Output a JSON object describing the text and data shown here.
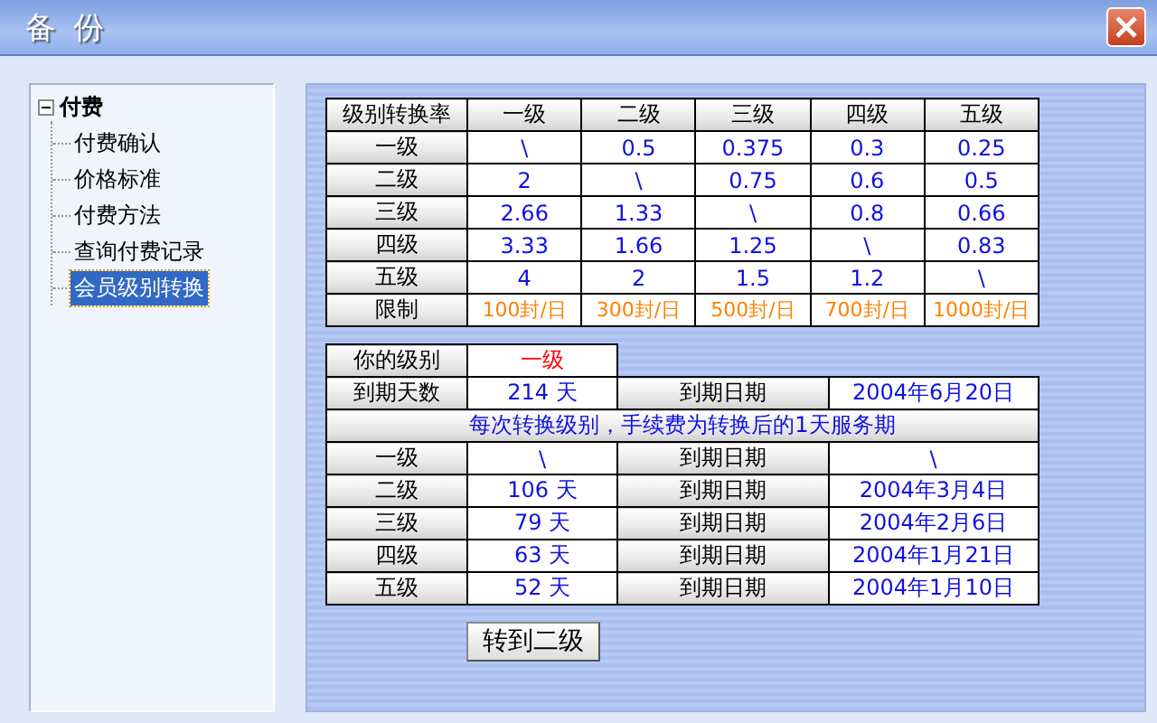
{
  "window": {
    "title": "备 份"
  },
  "tree": {
    "label": "付费",
    "expanded": true,
    "children": [
      {
        "label": "付费确认",
        "selected": false
      },
      {
        "label": "价格标准",
        "selected": false
      },
      {
        "label": "付费方法",
        "selected": false
      },
      {
        "label": "查询付费记录",
        "selected": false
      },
      {
        "label": "会员级别转换",
        "selected": true
      }
    ]
  },
  "rate_table": {
    "header": [
      "级别转换率",
      "一级",
      "二级",
      "三级",
      "四级",
      "五级"
    ],
    "rows": [
      {
        "label": "一级",
        "cells": [
          "\\",
          "0.5",
          "0.375",
          "0.3",
          "0.25"
        ]
      },
      {
        "label": "二级",
        "cells": [
          "2",
          "\\",
          "0.75",
          "0.6",
          "0.5"
        ]
      },
      {
        "label": "三级",
        "cells": [
          "2.66",
          "1.33",
          "\\",
          "0.8",
          "0.66"
        ]
      },
      {
        "label": "四级",
        "cells": [
          "3.33",
          "1.66",
          "1.25",
          "\\",
          "0.83"
        ]
      },
      {
        "label": "五级",
        "cells": [
          "4",
          "2",
          "1.5",
          "1.2",
          "\\"
        ]
      }
    ],
    "limit_row": {
      "label": "限制",
      "cells": [
        "100封/日",
        "300封/日",
        "500封/日",
        "700封/日",
        "1000封/日"
      ]
    }
  },
  "level_table": {
    "your_level": {
      "label": "你的级别",
      "value": "一级"
    },
    "current": {
      "label": "到期天数",
      "days": "214 天",
      "date_label": "到期日期",
      "date": "2004年6月20日"
    },
    "note": "每次转换级别，手续费为转换后的1天服务期",
    "rows": [
      {
        "label": "一级",
        "days": "\\",
        "date_label": "到期日期",
        "date": "\\"
      },
      {
        "label": "二级",
        "days": "106 天",
        "date_label": "到期日期",
        "date": "2004年3月4日"
      },
      {
        "label": "三级",
        "days": "79 天",
        "date_label": "到期日期",
        "date": "2004年2月6日"
      },
      {
        "label": "四级",
        "days": "63 天",
        "date_label": "到期日期",
        "date": "2004年1月21日"
      },
      {
        "label": "五级",
        "days": "52 天",
        "date_label": "到期日期",
        "date": "2004年1月10日"
      }
    ]
  },
  "button": "转到二级"
}
